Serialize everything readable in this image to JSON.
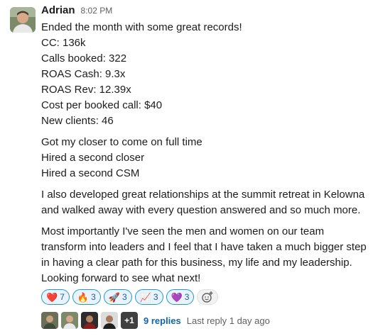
{
  "message": {
    "author": "Adrian",
    "time": "8:02 PM",
    "lines_block1": [
      "Ended the month with some great records!",
      "CC: 136k",
      "Calls booked: 322",
      "ROAS Cash: 9.3x",
      "ROAS Rev: 12.39x",
      "Cost per booked call: $40",
      "New clients: 46"
    ],
    "lines_block2": [
      "Got my closer to come on full time",
      "Hired a second closer",
      "Hired a second CSM"
    ],
    "para3": "I also developed great relationships at the summit retreat in Kelowna and walked away with every question answered and so much more.",
    "para4": "Most importantly I've seen the men and women on our team transform into leaders and I feel that I have taken a much bigger step in having a clear path for this business, my life and my leadership. Looking forward to see what next!"
  },
  "reactions": [
    {
      "emoji": "❤️",
      "icon": "heart-icon",
      "count": "7"
    },
    {
      "emoji": "🔥",
      "icon": "fire-icon",
      "count": "3"
    },
    {
      "emoji": "🚀",
      "icon": "rocket-icon",
      "count": "3"
    },
    {
      "emoji": "📈",
      "icon": "chart-increasing-icon",
      "count": "3"
    },
    {
      "emoji": "💜",
      "icon": "purple-heart-icon",
      "count": "3"
    }
  ],
  "thread": {
    "more_avatars": "+1",
    "replies": "9 replies",
    "last_reply": "Last reply 1 day ago"
  },
  "colors": {
    "link": "#1264a3",
    "reaction_bg": "#eaf2fb",
    "reaction_border": "#1d9bd1",
    "muted": "#616061"
  }
}
